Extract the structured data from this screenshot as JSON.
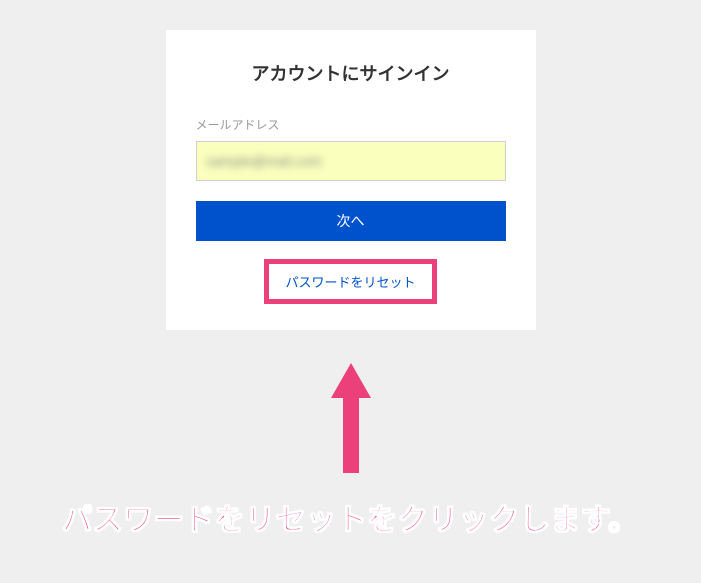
{
  "card": {
    "title": "アカウントにサインイン",
    "email_label": "メールアドレス",
    "email_value": "sample@mail.com",
    "next_button": "次へ",
    "reset_link": "パスワードをリセット"
  },
  "annotation": {
    "instruction": "パスワードをリセットをクリックします。",
    "highlight_color": "#ec407a"
  }
}
